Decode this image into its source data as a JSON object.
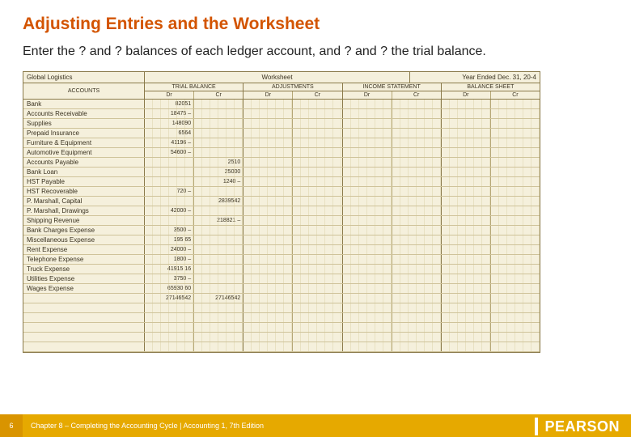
{
  "title": "Adjusting Entries and the Worksheet",
  "body": "Enter the ? and ? balances of each ledger account, and ? and ? the trial balance.",
  "worksheet": {
    "company": "Global Logistics",
    "title": "Worksheet",
    "period": "Year Ended Dec. 31, 20-4",
    "accounts_head": "ACCOUNTS",
    "sections": [
      "TRIAL BALANCE",
      "ADJUSTMENTS",
      "INCOME STATEMENT",
      "BALANCE SHEET"
    ],
    "drcr": [
      "Dr",
      "Cr",
      "Dr",
      "Cr",
      "Dr",
      "Cr",
      "Dr",
      "Cr"
    ],
    "rows": [
      {
        "acct": "Bank",
        "cols": [
          "82051",
          "",
          "",
          "",
          "",
          "",
          "",
          ""
        ]
      },
      {
        "acct": "Accounts Receivable",
        "cols": [
          "18475 –",
          "",
          "",
          "",
          "",
          "",
          "",
          ""
        ]
      },
      {
        "acct": "Supplies",
        "cols": [
          "148090",
          "",
          "",
          "",
          "",
          "",
          "",
          ""
        ]
      },
      {
        "acct": "Prepaid Insurance",
        "cols": [
          "6564",
          "",
          "",
          "",
          "",
          "",
          "",
          ""
        ]
      },
      {
        "acct": "Furniture & Equipment",
        "cols": [
          "41196 –",
          "",
          "",
          "",
          "",
          "",
          "",
          ""
        ]
      },
      {
        "acct": "Automotive Equipment",
        "cols": [
          "54600 –",
          "",
          "",
          "",
          "",
          "",
          "",
          ""
        ]
      },
      {
        "acct": "Accounts Payable",
        "cols": [
          "",
          "2510",
          "",
          "",
          "",
          "",
          "",
          ""
        ]
      },
      {
        "acct": "Bank Loan",
        "cols": [
          "",
          "25000",
          "",
          "",
          "",
          "",
          "",
          ""
        ]
      },
      {
        "acct": "HST Payable",
        "cols": [
          "",
          "1240 –",
          "",
          "",
          "",
          "",
          "",
          ""
        ]
      },
      {
        "acct": "HST Recoverable",
        "cols": [
          "720 –",
          "",
          "",
          "",
          "",
          "",
          "",
          ""
        ]
      },
      {
        "acct": "P. Marshall, Capital",
        "cols": [
          "",
          "2839542",
          "",
          "",
          "",
          "",
          "",
          ""
        ]
      },
      {
        "acct": "P. Marshall, Drawings",
        "cols": [
          "42000 –",
          "",
          "",
          "",
          "",
          "",
          "",
          ""
        ]
      },
      {
        "acct": "Shipping Revenue",
        "cols": [
          "",
          "218821 –",
          "",
          "",
          "",
          "",
          "",
          ""
        ]
      },
      {
        "acct": "Bank Charges Expense",
        "cols": [
          "3500 –",
          "",
          "",
          "",
          "",
          "",
          "",
          ""
        ]
      },
      {
        "acct": "Miscellaneous Expense",
        "cols": [
          "195 65",
          "",
          "",
          "",
          "",
          "",
          "",
          ""
        ]
      },
      {
        "acct": "Rent Expense",
        "cols": [
          "24000 –",
          "",
          "",
          "",
          "",
          "",
          "",
          ""
        ]
      },
      {
        "acct": "Telephone Expense",
        "cols": [
          "1800 –",
          "",
          "",
          "",
          "",
          "",
          "",
          ""
        ]
      },
      {
        "acct": "Truck Expense",
        "cols": [
          "41915 16",
          "",
          "",
          "",
          "",
          "",
          "",
          ""
        ]
      },
      {
        "acct": "Utilities Expense",
        "cols": [
          "3750 –",
          "",
          "",
          "",
          "",
          "",
          "",
          ""
        ]
      },
      {
        "acct": "Wages Expense",
        "cols": [
          "65930 60",
          "",
          "",
          "",
          "",
          "",
          "",
          ""
        ]
      },
      {
        "acct": "",
        "cols": [
          "27146542",
          "27146542",
          "",
          "",
          "",
          "",
          "",
          ""
        ],
        "total": true
      },
      {
        "acct": "",
        "cols": [
          "",
          "",
          "",
          "",
          "",
          "",
          "",
          ""
        ]
      },
      {
        "acct": "",
        "cols": [
          "",
          "",
          "",
          "",
          "",
          "",
          "",
          ""
        ]
      },
      {
        "acct": "",
        "cols": [
          "",
          "",
          "",
          "",
          "",
          "",
          "",
          ""
        ]
      },
      {
        "acct": "",
        "cols": [
          "",
          "",
          "",
          "",
          "",
          "",
          "",
          ""
        ]
      },
      {
        "acct": "",
        "cols": [
          "",
          "",
          "",
          "",
          "",
          "",
          "",
          ""
        ]
      }
    ]
  },
  "footer": {
    "page": "6",
    "text": "Chapter 8 – Completing the Accounting Cycle | Accounting 1, 7th Edition"
  },
  "brand": "PEARSON"
}
